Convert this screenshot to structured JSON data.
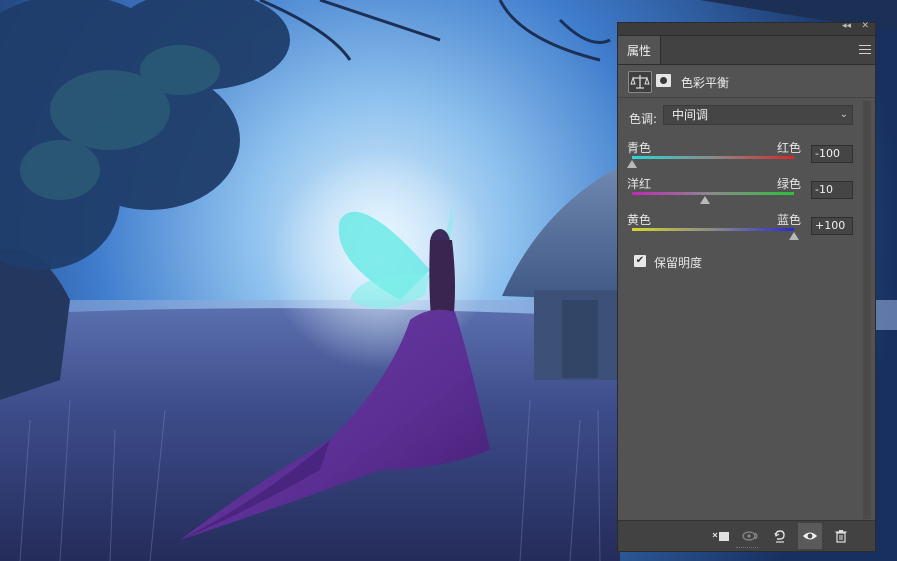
{
  "panel": {
    "tab_label": "属性",
    "title": "色彩平衡",
    "tone_label": "色调:",
    "tone_value": "中间调",
    "sliders": [
      {
        "left": "青色",
        "right": "红色",
        "value": "-100",
        "numeric": -100
      },
      {
        "left": "洋红",
        "right": "绿色",
        "value": "-10",
        "numeric": -10
      },
      {
        "left": "黄色",
        "right": "蓝色",
        "value": "+100",
        "numeric": 100
      }
    ],
    "preserve_luminosity": {
      "label": "保留明度",
      "checked": true
    },
    "bottom_icons": [
      "clip-to-layer-icon",
      "view-previous-icon",
      "reset-icon",
      "visibility-eye-icon",
      "trash-icon"
    ]
  },
  "colors": {
    "panel_bg": "#535353",
    "cyan": "#2ad6d6",
    "red": "#d42a2a",
    "magenta": "#c02ab8",
    "green": "#2ac23a",
    "yellow": "#d6d62a",
    "blue": "#2a2ad0"
  }
}
